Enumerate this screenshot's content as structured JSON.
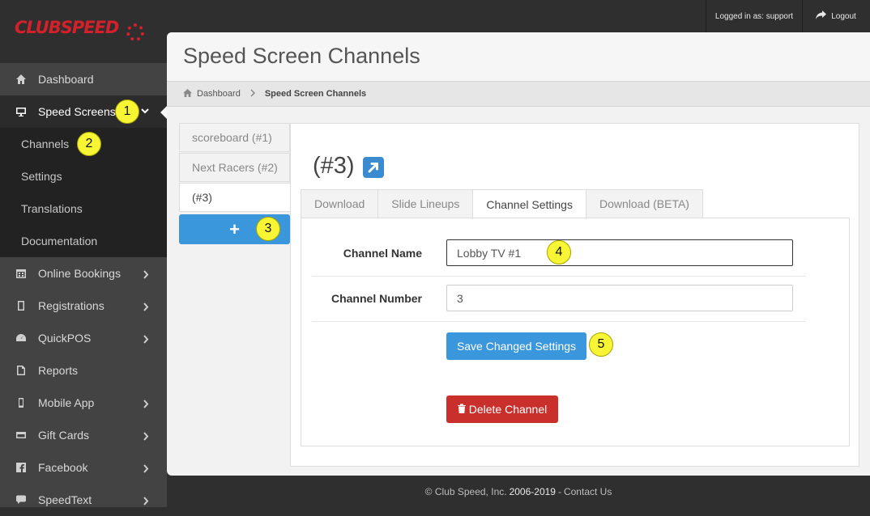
{
  "app": {
    "brand": "CLUBSPEED"
  },
  "topbar": {
    "logged_in": "Logged in as: support",
    "logout_label": "Logout"
  },
  "sidebar": {
    "items": [
      {
        "label": "Dashboard",
        "icon": "home-icon",
        "chevron": ""
      },
      {
        "label": "Speed Screens",
        "icon": "monitor-icon",
        "chevron": "⌄"
      },
      {
        "label": "Online Bookings",
        "icon": "calendar-icon",
        "chevron": "›"
      },
      {
        "label": "Registrations",
        "icon": "tablet-icon",
        "chevron": "›"
      },
      {
        "label": "QuickPOS",
        "icon": "dashboard-icon",
        "chevron": "›"
      },
      {
        "label": "Reports",
        "icon": "file-icon",
        "chevron": ""
      },
      {
        "label": "Mobile App",
        "icon": "phone-icon",
        "chevron": "›"
      },
      {
        "label": "Gift Cards",
        "icon": "credit-card-icon",
        "chevron": "›"
      },
      {
        "label": "Facebook",
        "icon": "facebook-icon",
        "chevron": "›"
      },
      {
        "label": "SpeedText",
        "icon": "chat-icon",
        "chevron": "›"
      }
    ],
    "submenu": [
      "Channels",
      "Settings",
      "Translations",
      "Documentation"
    ]
  },
  "page": {
    "title": "Speed Screen Channels"
  },
  "breadcrumb": {
    "home": "Dashboard",
    "current": "Speed Screen Channels"
  },
  "channels": {
    "list": [
      "scoreboard (#1)",
      "Next Racers (#2)",
      "(#3)"
    ],
    "add_label": "+"
  },
  "channel": {
    "title": "(#3)",
    "tabs": [
      "Download",
      "Slide Lineups",
      "Channel Settings",
      "Download (BETA)"
    ],
    "name_label": "Channel Name",
    "name_value": "Lobby TV #1",
    "number_label": "Channel Number",
    "number_value": "3",
    "save_label": "Save Changed Settings",
    "delete_label": "Delete Channel"
  },
  "footer": {
    "copyright": "© Club Speed, Inc.",
    "years": "2006-2019",
    "separator": "-",
    "contact": "Contact Us"
  },
  "markers": [
    "1",
    "2",
    "3",
    "4",
    "5"
  ],
  "colors": {
    "accent": "#3a97dc",
    "danger": "#c9302c",
    "brand": "#d4202a",
    "marker": "#f8f534"
  }
}
